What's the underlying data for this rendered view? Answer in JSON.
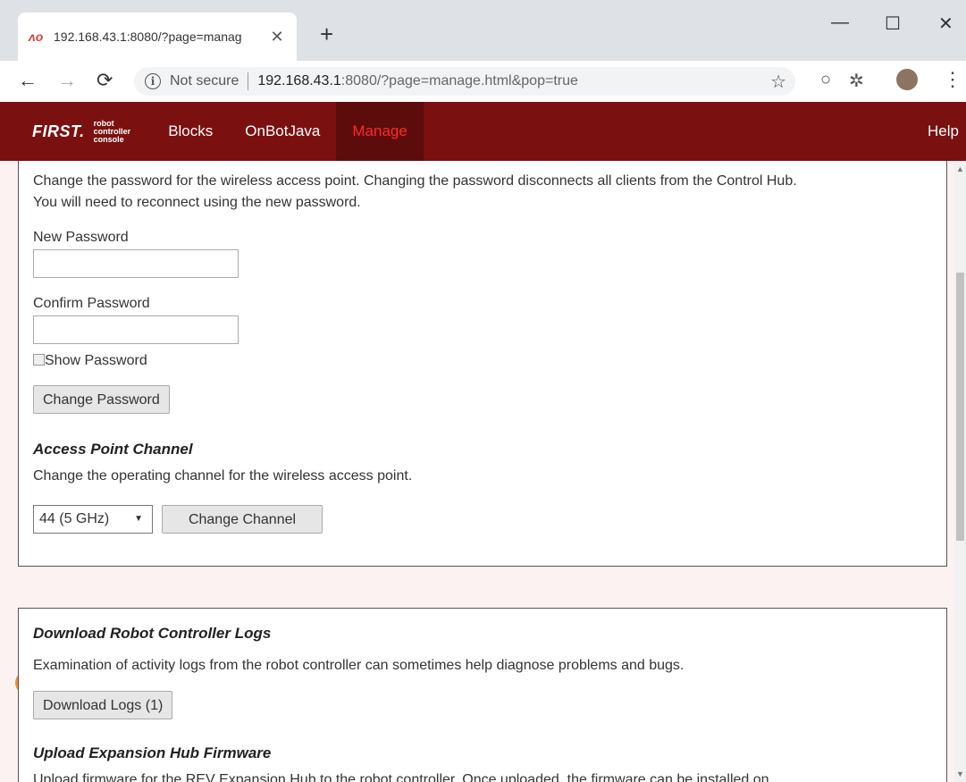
{
  "browser": {
    "tab_title": "192.168.43.1:8080/?page=manag",
    "new_tab": "+",
    "minimize": "—",
    "maximize": "☐",
    "close": "✕",
    "url_security": "Not secure",
    "url_host": "192.168.43.1",
    "url_rest": ":8080/?page=manage.html&pop=true"
  },
  "nav": {
    "logo_first": "FIRST.",
    "logo_sub": [
      "robot",
      "controller",
      "console"
    ],
    "items": [
      {
        "label": "Blocks",
        "active": false
      },
      {
        "label": "OnBotJava",
        "active": false
      },
      {
        "label": "Manage",
        "active": true
      }
    ],
    "help": "Help"
  },
  "password_section": {
    "description_line1": "Change the password for the wireless access point. Changing the password disconnects all clients from the Control Hub.",
    "description_line2": "You will need to reconnect using the new password.",
    "new_password_label": "New Password",
    "new_password_value": "",
    "confirm_password_label": "Confirm Password",
    "confirm_password_value": "",
    "show_password_label": "Show Password",
    "show_password_checked": false,
    "change_button": "Change Password"
  },
  "channel_section": {
    "heading": "Access Point Channel",
    "description": "Change the operating channel for the wireless access point.",
    "selected_channel": "44 (5 GHz)",
    "change_button": "Change Channel",
    "highlight_color": "#f08a2c"
  },
  "logs_section": {
    "heading": "Download Robot Controller Logs",
    "description": "Examination of activity logs from the robot controller can sometimes help diagnose problems and bugs.",
    "download_button": "Download Logs (1)"
  },
  "firmware_section": {
    "heading": "Upload Expansion Hub Firmware",
    "description": "Upload firmware for the REV Expansion Hub to the robot controller. Once uploaded, the firmware can be installed on"
  },
  "colors": {
    "nav_bg": "#7b1010",
    "nav_active_bg": "#5d0c0c",
    "nav_active_text": "#ff2a2a",
    "page_bg": "#fdf2f2"
  }
}
